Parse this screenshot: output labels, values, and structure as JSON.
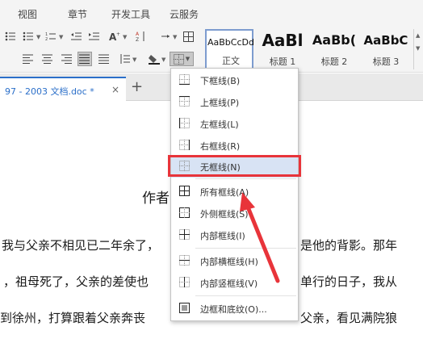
{
  "menubar": {
    "tabs": [
      {
        "label": "视图"
      },
      {
        "label": "章节"
      },
      {
        "label": "开发工具"
      },
      {
        "label": "云服务"
      }
    ]
  },
  "ribbon": {
    "styles": [
      {
        "sample": "AaBbCcDd",
        "name": "正文"
      },
      {
        "sample": "AaBl",
        "name": "标题 1"
      },
      {
        "sample": "AaBb(",
        "name": "标题 2"
      },
      {
        "sample": "AaBbC",
        "name": "标题 3"
      }
    ]
  },
  "tabbar": {
    "doc_tab_label": "97 - 2003 文档.doc *",
    "close_glyph": "×",
    "new_tab_glyph": "+"
  },
  "document": {
    "author_line": "作者",
    "lines": [
      "我与父亲不相见已二年余了，",
      "，祖母死了，父亲的差使也",
      "到徐州，打算跟着父亲奔丧"
    ],
    "right_lines": [
      "是他的背影。那年",
      "单行的日子，我从",
      "父亲，看见满院狼"
    ]
  },
  "dropdown": {
    "items": [
      {
        "label": "下框线(B)",
        "icon": "border-bottom-icon"
      },
      {
        "label": "上框线(P)",
        "icon": "border-top-icon"
      },
      {
        "label": "左框线(L)",
        "icon": "border-left-icon"
      },
      {
        "label": "右框线(R)",
        "icon": "border-right-icon"
      },
      {
        "label": "无框线(N)",
        "icon": "no-border-icon"
      },
      {
        "label": "所有框线(A)",
        "icon": "all-borders-icon"
      },
      {
        "label": "外侧框线(S)",
        "icon": "outside-borders-icon"
      },
      {
        "label": "内部框线(I)",
        "icon": "inside-borders-icon"
      },
      {
        "label": "内部横框线(H)",
        "icon": "inside-horizontal-border-icon"
      },
      {
        "label": "内部竖框线(V)",
        "icon": "inside-vertical-border-icon"
      },
      {
        "label": "边框和底纹(O)...",
        "icon": "borders-shading-icon"
      }
    ],
    "highlighted_item": "无框线(N)"
  },
  "colors": {
    "accent": "#2b6fc9",
    "annotation_red": "#e8343a",
    "highlight": "#d8e3f4"
  }
}
